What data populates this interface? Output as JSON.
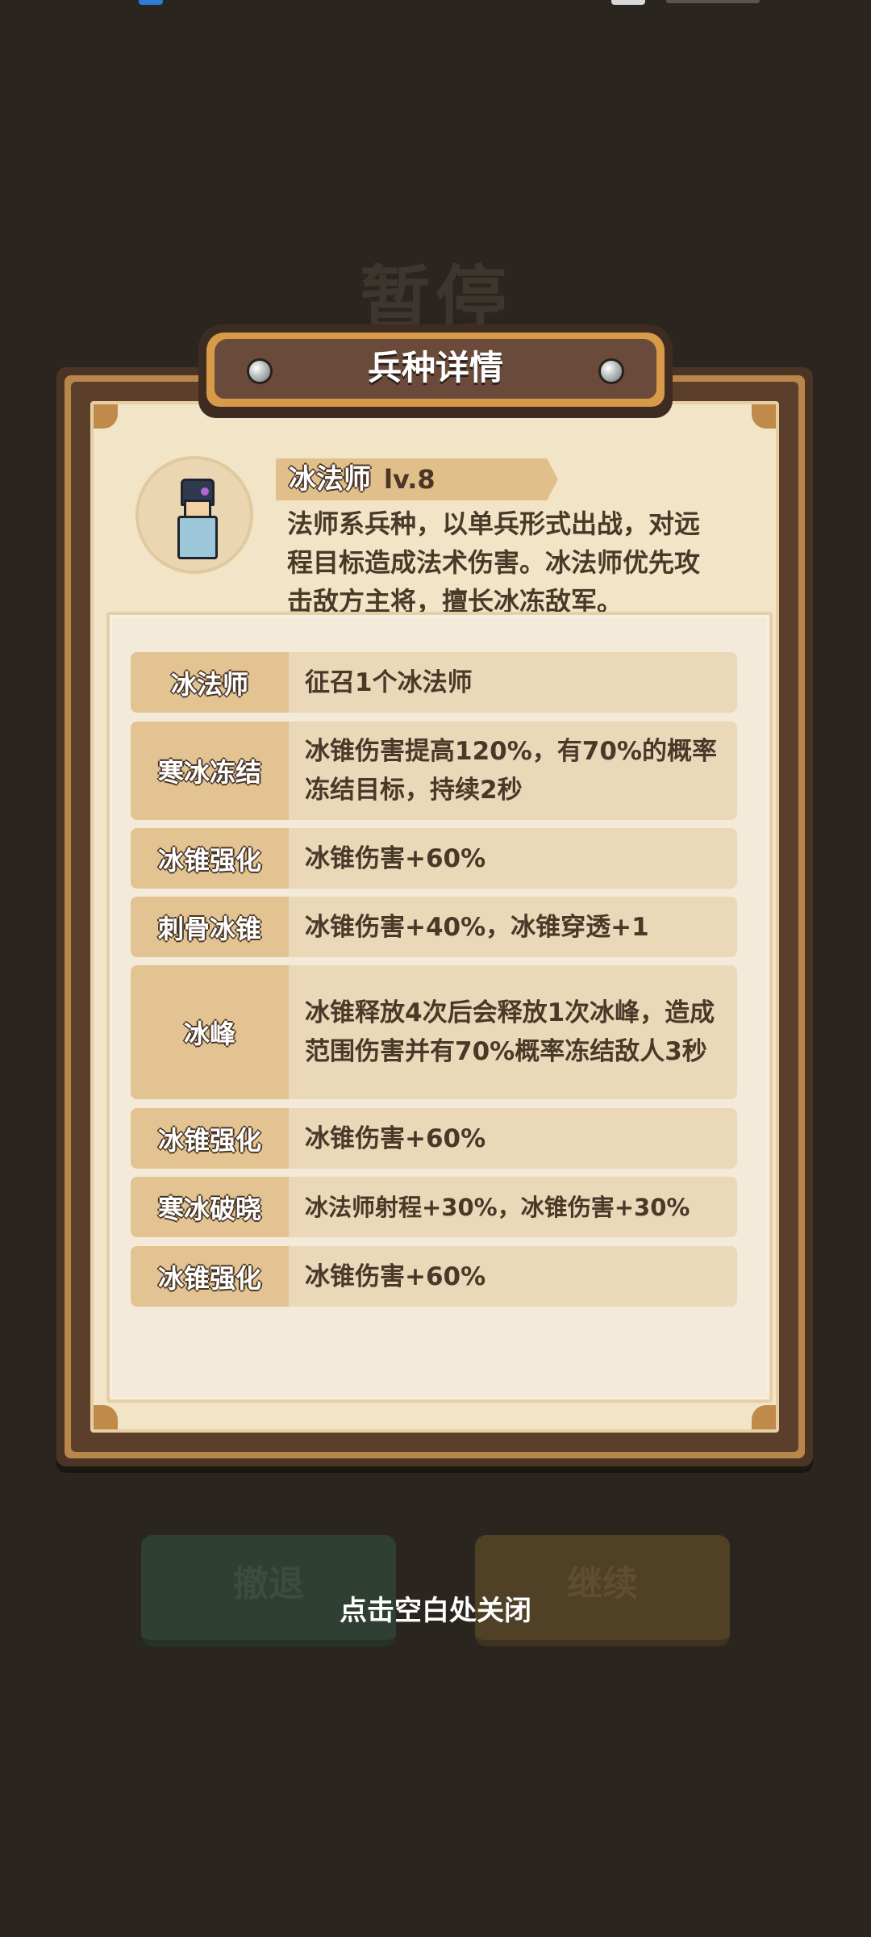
{
  "background": {
    "title": "暂停",
    "retreat_button": "撤退",
    "continue_button": "继续"
  },
  "panel": {
    "title": "兵种详情",
    "unit": {
      "icon": "ice-mage-portrait",
      "name": "冰法师",
      "level": "lv.8",
      "description": "法师系兵种，以单兵形式出战，对远程目标造成法术伤害。冰法师优先攻击敌方主将，擅长冰冻敌军。"
    },
    "skills": [
      {
        "label": "冰法师",
        "value": "征召1个冰法师"
      },
      {
        "label": "寒冰冻结",
        "value": "冰锥伤害提高120%，有70%的概率冻结目标，持续2秒"
      },
      {
        "label": "冰锥强化",
        "value": "冰锥伤害+60%"
      },
      {
        "label": "刺骨冰锥",
        "value": "冰锥伤害+40%，冰锥穿透+1"
      },
      {
        "label": "冰峰",
        "value": "冰锥释放4次后会释放1次冰峰，造成范围伤害并有70%概率冻结敌人3秒"
      },
      {
        "label": "冰锥强化",
        "value": "冰锥伤害+60%"
      },
      {
        "label": "寒冰破晓",
        "value": "冰法师射程+30%，冰锥伤害+30%"
      },
      {
        "label": "冰锥强化",
        "value": "冰锥伤害+60%"
      }
    ]
  },
  "close_hint": "点击空白处关闭",
  "colors": {
    "backdrop": "#2b2520",
    "parchment": "#f2e4c6",
    "label_cell": "#e2c391",
    "value_cell": "#ead8b9",
    "text_dark": "#4a3929"
  }
}
